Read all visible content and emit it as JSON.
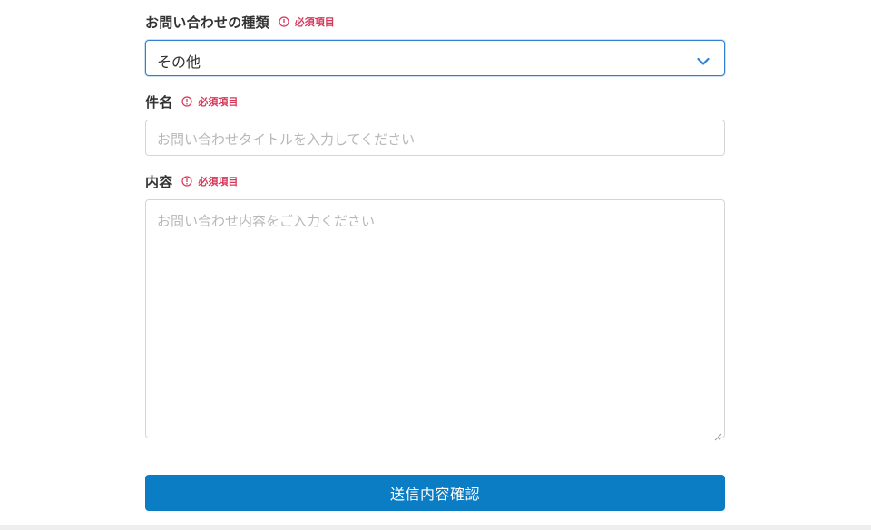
{
  "form": {
    "inquiry_type": {
      "label": "お問い合わせの種類",
      "required_label": "必須項目",
      "selected_value": "その他"
    },
    "subject": {
      "label": "件名",
      "required_label": "必須項目",
      "placeholder": "お問い合わせタイトルを入力してください",
      "value": ""
    },
    "content": {
      "label": "内容",
      "required_label": "必須項目",
      "placeholder": "お問い合わせ内容をご入力ください",
      "value": ""
    },
    "submit_label": "送信内容確認"
  },
  "colors": {
    "required": "#d6385a",
    "focus_border": "#2f80d1",
    "button": "#0a7dc4",
    "input_border": "#d5d5d5",
    "placeholder": "#b8b8b8"
  },
  "icons": {
    "required": "exclamation-circle-icon",
    "select": "chevron-down-icon",
    "resize": "resize-grip-icon"
  }
}
